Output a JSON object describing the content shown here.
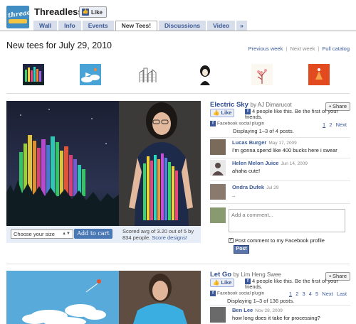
{
  "header": {
    "page_name": "Threadless",
    "logo_text": "threadless",
    "like_label": "Like",
    "tabs": [
      {
        "label": "Wall",
        "active": false
      },
      {
        "label": "Info",
        "active": false
      },
      {
        "label": "Events",
        "active": false
      },
      {
        "label": "New Tees!",
        "active": true
      },
      {
        "label": "Discussions",
        "active": false
      },
      {
        "label": "Video",
        "active": false
      },
      {
        "label": "»",
        "active": false
      }
    ]
  },
  "main": {
    "title": "New tees for July 29, 2010",
    "nav": {
      "previous": "Previous week",
      "next": "Next week",
      "full": "Full catalog",
      "sep": "|"
    }
  },
  "posts": [
    {
      "title": "Electric Sky",
      "author": "by AJ Dimarucot",
      "share": "Share",
      "like": "Like",
      "like_count": "4 people like this. Be the first of your friends.",
      "plugin": "Facebook social plugin",
      "displaying": "Displaying 1–3 of 4 posts.",
      "pages": [
        "1",
        "2",
        "Next"
      ],
      "size_label": "Choose your size",
      "cart_label": "Add to cart",
      "score": "Scored avg of 3.20 out of 5 by 834 people.",
      "score_link": "Score designs!",
      "comments": [
        {
          "name": "Lucas Burger",
          "date": "May 17, 2009",
          "text": "I'm gonna spend like 400 bucks here i swear"
        },
        {
          "name": "Helen Melon Juice",
          "date": "Jun 14, 2009",
          "text": "ahaha cute!"
        },
        {
          "name": "Ondra Dufek",
          "date": "Jul 29",
          "text": ".."
        }
      ],
      "comment_placeholder": "Add a comment...",
      "post_to_fb": "Post comment to my Facebook profile",
      "post_btn": "Post"
    },
    {
      "title": "Let Go",
      "author": "by Lim Heng Swee",
      "share": "Share",
      "like": "Like",
      "like_count": "4 people like this. Be the first of your friends.",
      "plugin": "Facebook social plugin",
      "displaying": "Displaying 1–3 of 136 posts.",
      "pages": [
        "1",
        "2",
        "3",
        "4",
        "5",
        "Next",
        "Last"
      ],
      "comments": [
        {
          "name": "Ben Lee",
          "date": "Nov 28, 2009",
          "text": "how long does it take for processing?"
        }
      ]
    }
  ],
  "colors": {
    "link": "#3b5998",
    "tab_bg": "#d8dfea",
    "buy_bar": "#e8eef7"
  }
}
